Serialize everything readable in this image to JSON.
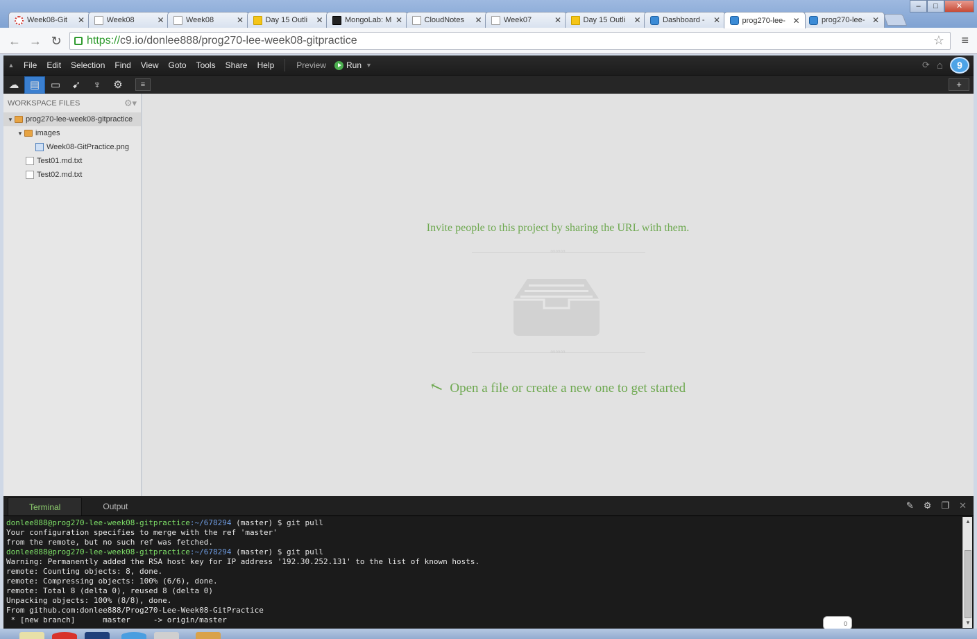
{
  "browser": {
    "tabs": [
      {
        "title": "Week08-Git",
        "icon": "red-dots-icon"
      },
      {
        "title": "Week08",
        "icon": "page-icon"
      },
      {
        "title": "Week08",
        "icon": "page-icon"
      },
      {
        "title": "Day 15 Outli",
        "icon": "slides-icon"
      },
      {
        "title": "MongoLab: M",
        "icon": "mongo-icon"
      },
      {
        "title": "CloudNotes",
        "icon": "page-icon"
      },
      {
        "title": "Week07",
        "icon": "page-icon"
      },
      {
        "title": "Day 15 Outli",
        "icon": "slides-icon"
      },
      {
        "title": "Dashboard -",
        "icon": "c9-icon"
      },
      {
        "title": "prog270-lee-",
        "icon": "c9-icon"
      },
      {
        "title": "prog270-lee-",
        "icon": "c9-icon"
      }
    ],
    "url_scheme": "https://",
    "url_rest": "c9.io/donlee888/prog270-lee-week08-gitpractice"
  },
  "ide": {
    "menu": [
      "File",
      "Edit",
      "Selection",
      "Find",
      "View",
      "Goto",
      "Tools",
      "Share",
      "Help"
    ],
    "preview_label": "Preview",
    "run_label": "Run",
    "logo_text": "9"
  },
  "sidebar": {
    "header": "WORKSPACE FILES",
    "tree": [
      {
        "label": "prog270-lee-week08-gitpractice",
        "type": "folder",
        "depth": 0,
        "twisty": "▼"
      },
      {
        "label": "images",
        "type": "folder",
        "depth": 1,
        "twisty": "▼"
      },
      {
        "label": "Week08-GitPractice.png",
        "type": "image",
        "depth": 2,
        "twisty": ""
      },
      {
        "label": "Test01.md.txt",
        "type": "file",
        "depth": 1,
        "twisty": ""
      },
      {
        "label": "Test02.md.txt",
        "type": "file",
        "depth": 1,
        "twisty": ""
      }
    ]
  },
  "editor": {
    "invite_text": "Invite people to this project by sharing the URL with them.",
    "open_hint": "Open a file or create a new one to get started"
  },
  "console": {
    "tabs": [
      "Terminal",
      "Output"
    ],
    "chat_count": "0",
    "lines": [
      {
        "user": "donlee888@prog270-lee-week08-gitpractice",
        "path": ":~/678294",
        "text": " (master) $ git pull"
      },
      {
        "text": "Your configuration specifies to merge with the ref 'master'"
      },
      {
        "text": "from the remote, but no such ref was fetched."
      },
      {
        "user": "donlee888@prog270-lee-week08-gitpractice",
        "path": ":~/678294",
        "text": " (master) $ git pull"
      },
      {
        "text": "Warning: Permanently added the RSA host key for IP address '192.30.252.131' to the list of known hosts."
      },
      {
        "text": "remote: Counting objects: 8, done."
      },
      {
        "text": "remote: Compressing objects: 100% (6/6), done."
      },
      {
        "text": "remote: Total 8 (delta 0), reused 8 (delta 0)"
      },
      {
        "text": "Unpacking objects: 100% (8/8), done."
      },
      {
        "text": "From github.com:donlee888/Prog270-Lee-Week08-GitPractice"
      },
      {
        "text": " * [new branch]      master     -> origin/master"
      }
    ]
  }
}
